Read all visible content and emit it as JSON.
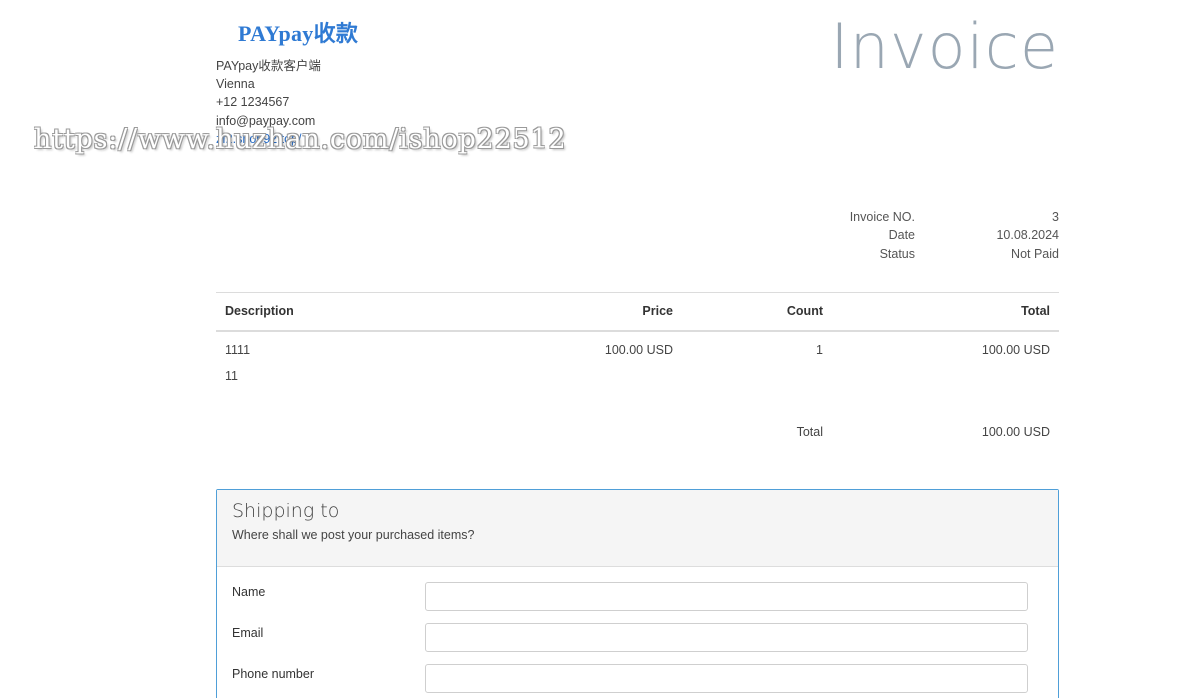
{
  "brand": {
    "logo_text": "PAYpay收款",
    "accent_color": "#2f7ad3"
  },
  "company": {
    "name": "PAYpay收款客户端",
    "city": "Vienna",
    "phone": "+12 1234567",
    "email": "info@paypay.com",
    "website": "zf2.shop92.top/"
  },
  "watermark": "https://www.huzhan.com/ishop22512",
  "invoice": {
    "title": "Invoice",
    "meta": [
      {
        "label": "Invoice NO.",
        "value": "3"
      },
      {
        "label": "Date",
        "value": "10.08.2024"
      },
      {
        "label": "Status",
        "value": "Not Paid"
      }
    ]
  },
  "items_table": {
    "headers": {
      "description": "Description",
      "price": "Price",
      "count": "Count",
      "total": "Total"
    },
    "rows": [
      {
        "description": "1111",
        "note": "11",
        "price": "100.00 USD",
        "count": "1",
        "total": "100.00 USD"
      }
    ],
    "total_label": "Total",
    "total_value": "100.00 USD"
  },
  "shipping": {
    "title": "Shipping to",
    "subtitle": "Where shall we post your purchased items?",
    "border_color": "#4f9fd8",
    "fields": [
      {
        "label": "Name",
        "value": "",
        "placeholder": ""
      },
      {
        "label": "Email",
        "value": "",
        "placeholder": ""
      },
      {
        "label": "Phone number",
        "value": "",
        "placeholder": ""
      }
    ]
  }
}
